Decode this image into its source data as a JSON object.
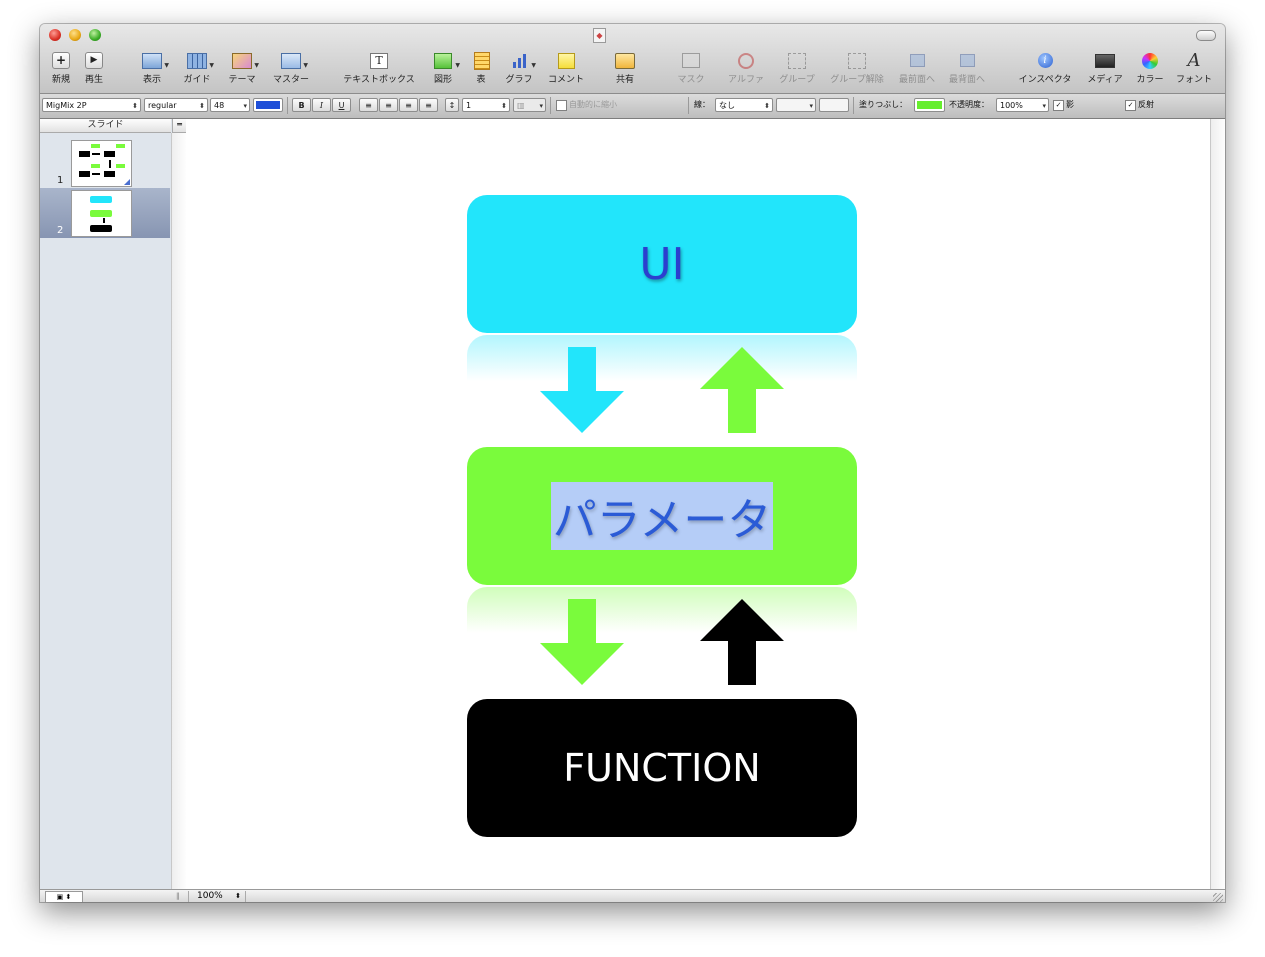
{
  "toolbar": {
    "new": "新規",
    "play": "再生",
    "view": "表示",
    "guides": "ガイド",
    "themes": "テーマ",
    "masters": "マスター",
    "textbox": "テキストボックス",
    "shapes": "図形",
    "table": "表",
    "chart": "グラフ",
    "comment": "コメント",
    "share": "共有",
    "mask": "マスク",
    "alpha": "アルファ",
    "group": "グループ",
    "ungroup": "グループ解除",
    "front": "最前面へ",
    "back": "最背面へ",
    "inspector": "インスペクタ",
    "media": "メディア",
    "colors": "カラー",
    "fonts": "フォント"
  },
  "format_bar": {
    "font_family": "MigMix 2P",
    "font_style": "regular",
    "font_size": "48",
    "text_color": "#1f4fd8",
    "bold": "B",
    "italic": "I",
    "underline": "U",
    "line_spacing": "1",
    "autoshrink_label": "自動的に縮小",
    "line_label": "線：",
    "line_value": "なし",
    "fill_label": "塗りつぶし：",
    "fill_color": "#66ee2e",
    "opacity_label": "不透明度：",
    "opacity_value": "100%",
    "shadow_label": "影",
    "shadow_checked": true,
    "reflection_label": "反射",
    "reflection_checked": true
  },
  "navigator": {
    "header": "スライド",
    "slides": [
      {
        "number": "1",
        "selected": false
      },
      {
        "number": "2",
        "selected": true
      }
    ]
  },
  "statusbar": {
    "zoom": "100%"
  },
  "slide": {
    "boxes": [
      {
        "label": "UI",
        "fill": "#22e5fb",
        "text_color": "#2b3fcf"
      },
      {
        "label": "パラメータ",
        "fill": "#7afb3c",
        "text_color": "#2b5bd6",
        "selection_highlight": "#b5cdf7"
      },
      {
        "label": "FUNCTION",
        "fill": "#000000",
        "text_color": "#ffffff"
      }
    ],
    "arrows": [
      {
        "direction": "down",
        "color": "#22e5fb"
      },
      {
        "direction": "up",
        "color": "#7afb3c"
      },
      {
        "direction": "down",
        "color": "#7afb3c"
      },
      {
        "direction": "up",
        "color": "#000000"
      }
    ]
  }
}
